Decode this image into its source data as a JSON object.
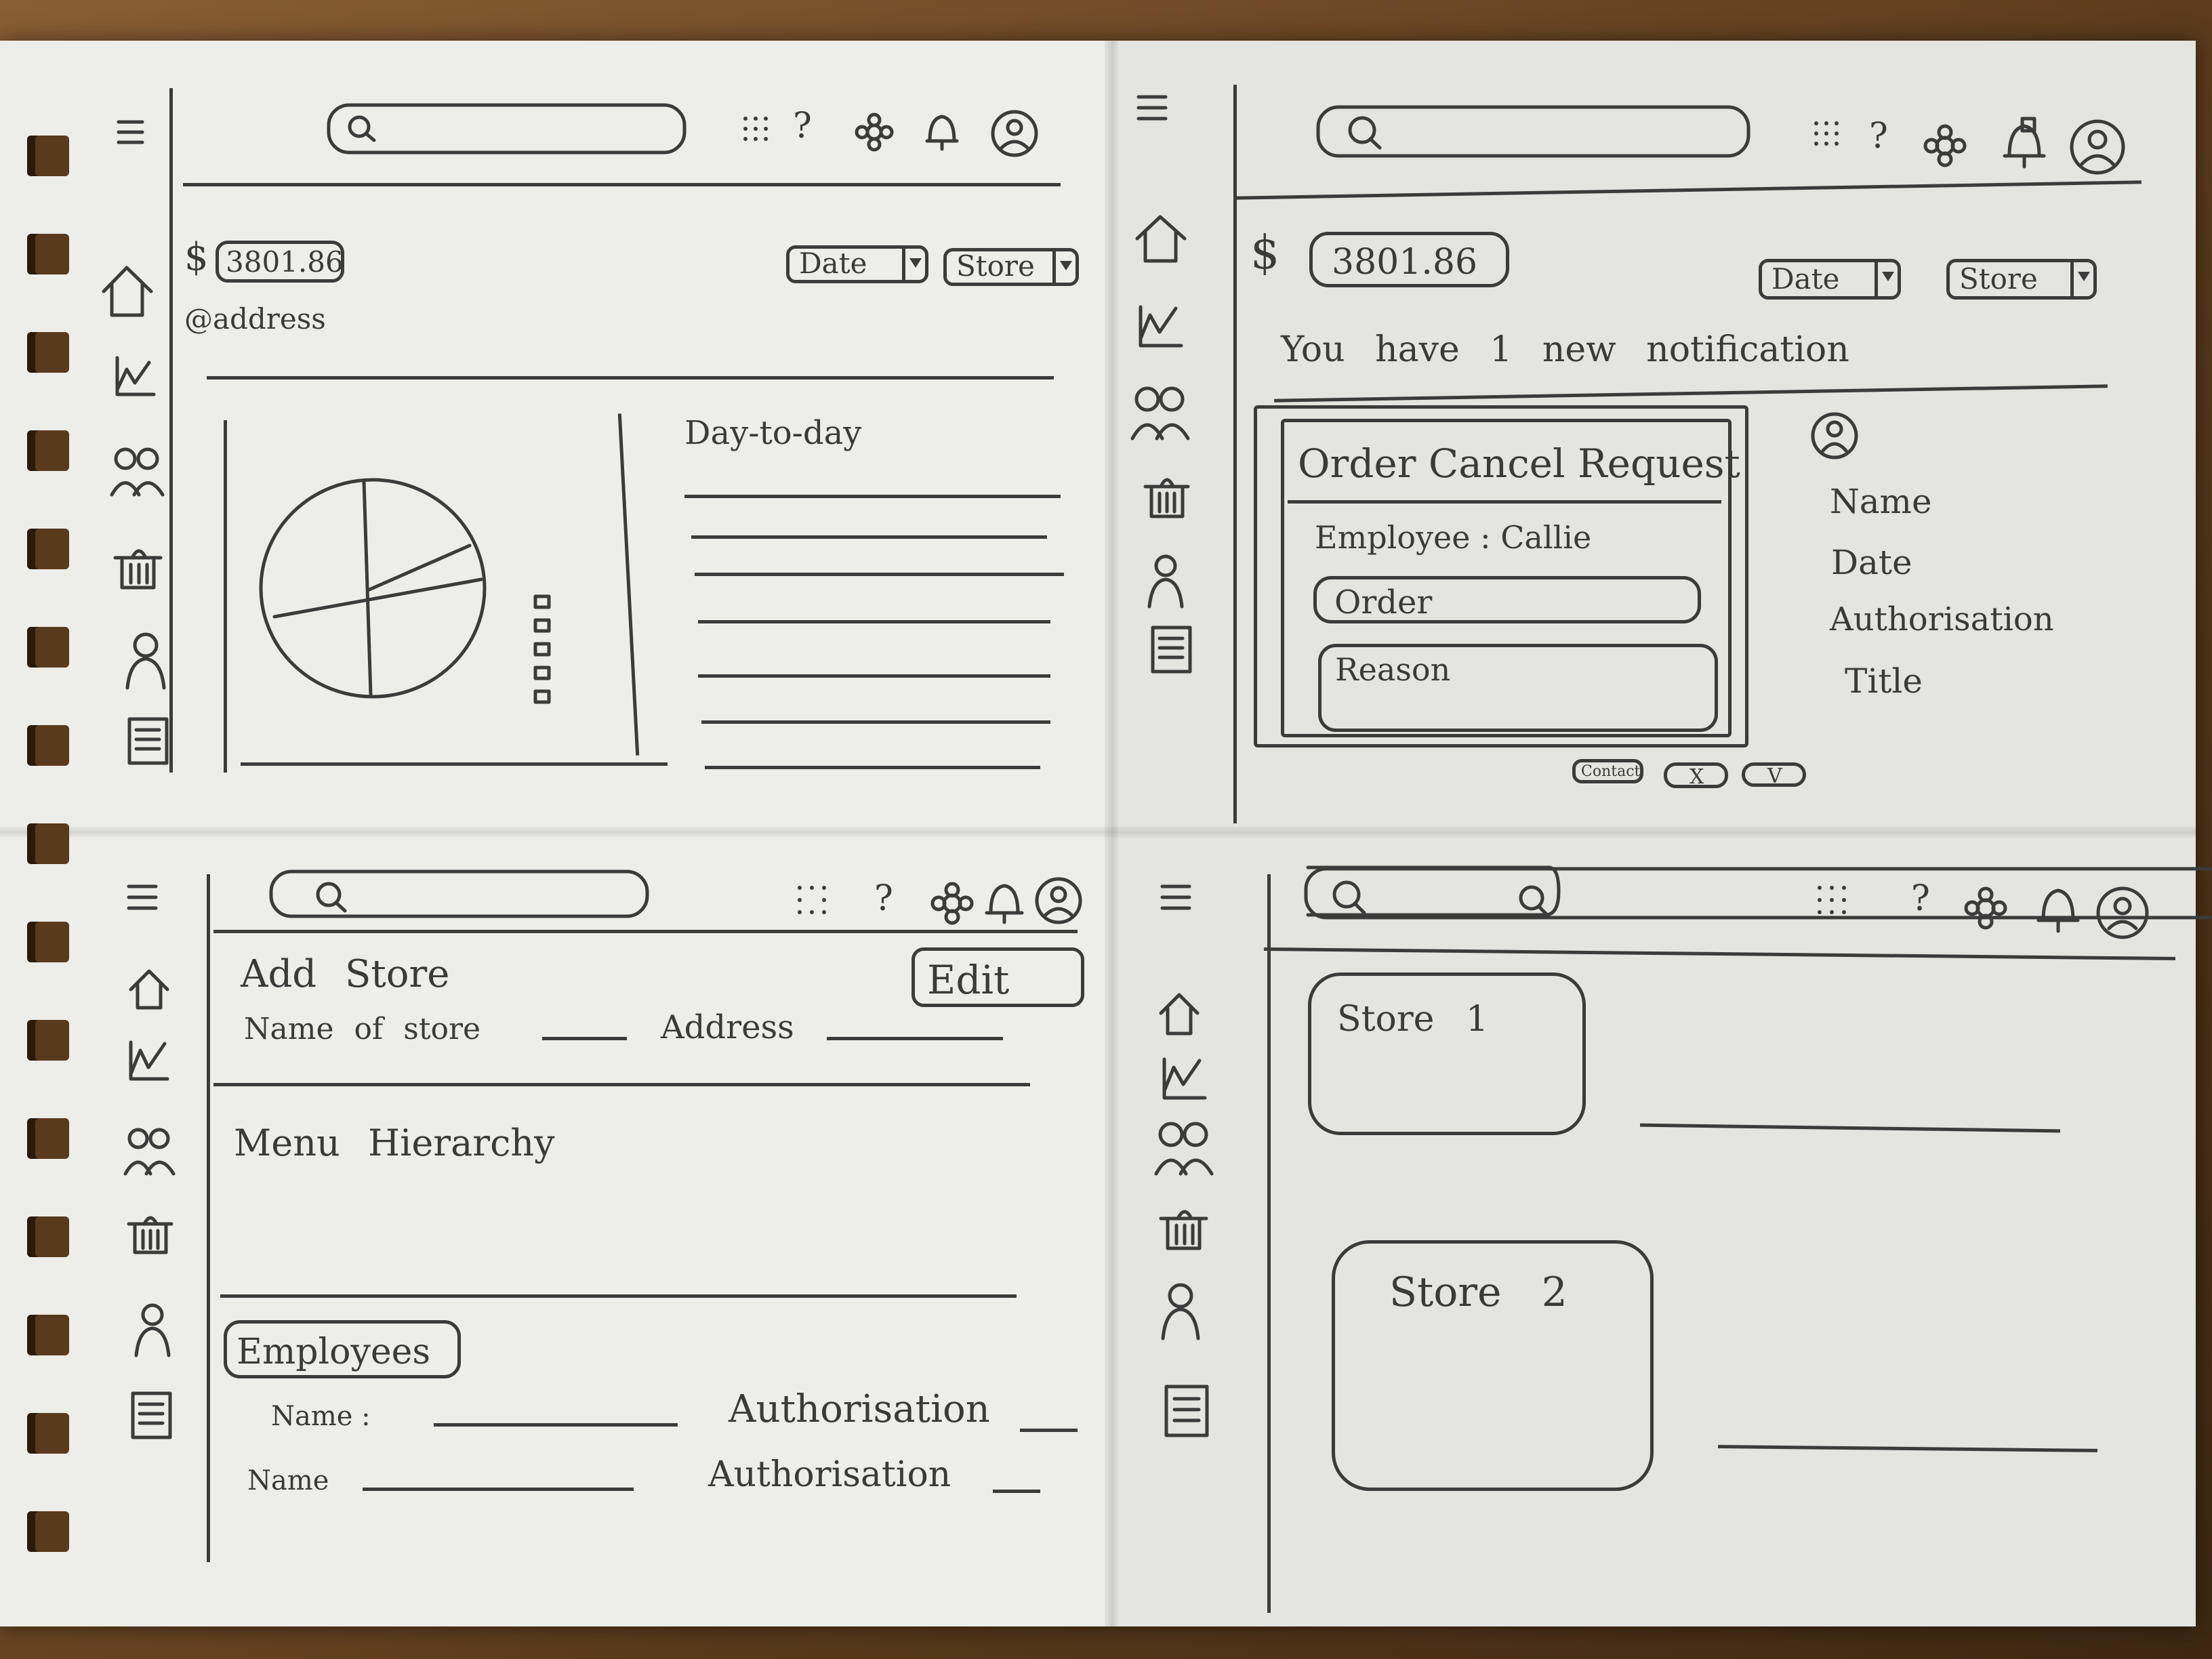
{
  "panel_dashboard": {
    "amount_prefix": "$",
    "amount": "3801.86",
    "address": "@address",
    "date_dropdown": "Date",
    "store_dropdown": "Store",
    "list_title": "Day-to-day"
  },
  "panel_notification": {
    "amount_prefix": "$",
    "amount": "3801.86",
    "date_dropdown": "Date",
    "store_dropdown": "Store",
    "notification_text": "You have 1 new notification",
    "card_title": "Order Cancel Request",
    "employee_label": "Employee : Callie",
    "order_field": "Order",
    "reason_field": "Reason",
    "contact_button": "Contact",
    "reject_button": "X",
    "accept_button": "V",
    "profile_fields": [
      "Name",
      "Date",
      "Authorisation",
      "Title"
    ]
  },
  "panel_add_store": {
    "title": "Add Store",
    "edit_button": "Edit",
    "name_of_store_label": "Name of store",
    "address_label": "Address",
    "menu_hierarchy_label": "Menu Hierarchy",
    "employees_tab": "Employees",
    "employee_rows": [
      {
        "name_label": "Name :",
        "auth_label": "Authorisation"
      },
      {
        "name_label": "Name",
        "auth_label": "Authorisation"
      }
    ]
  },
  "panel_stores": {
    "store_cards": [
      "Store 1",
      "Store 2"
    ]
  }
}
